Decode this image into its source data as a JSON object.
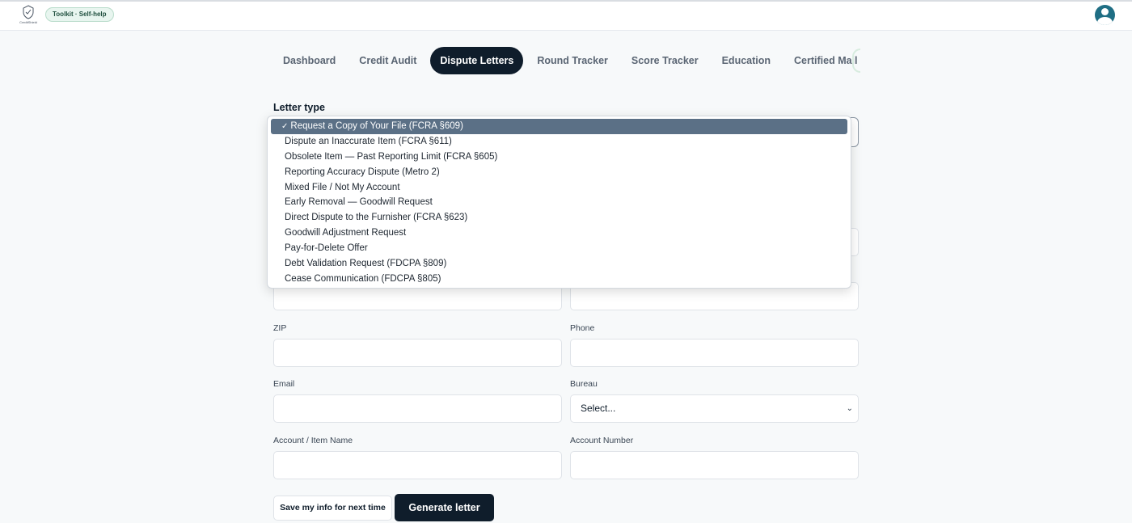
{
  "header": {
    "logo_text": "CreditShield",
    "badge": "Toolkit · Self-help"
  },
  "tabs": [
    {
      "label": "Dashboard",
      "active": false
    },
    {
      "label": "Credit Audit",
      "active": false
    },
    {
      "label": "Dispute Letters",
      "active": true
    },
    {
      "label": "Round Tracker",
      "active": false
    },
    {
      "label": "Score Tracker",
      "active": false
    },
    {
      "label": "Education",
      "active": false
    },
    {
      "label": "Certified Mail",
      "active": false
    }
  ],
  "form": {
    "letter_type_label": "Letter type",
    "letter_type_options": [
      "Request a Copy of Your File (FCRA §609)",
      "Dispute an Inaccurate Item (FCRA §611)",
      "Obsolete Item — Past Reporting Limit (FCRA §605)",
      "Reporting Accuracy Dispute (Metro 2)",
      "Mixed File / Not My Account",
      "Early Removal — Goodwill Request",
      "Direct Dispute to the Furnisher (FCRA §623)",
      "Goodwill Adjustment Request",
      "Pay-for-Delete Offer",
      "Debt Validation Request (FDCPA §809)",
      "Cease Communication (FDCPA §805)"
    ],
    "selected_check": "✓",
    "zip_label": "ZIP",
    "phone_label": "Phone",
    "email_label": "Email",
    "bureau_label": "Bureau",
    "bureau_value": "Select...",
    "account_label": "Account / Item Name",
    "account_number_label": "Account Number",
    "save_button": "Save my info for next time",
    "generate_button": "Generate letter"
  },
  "colors": {
    "primary": "#0f1d2b",
    "selected_option": "#5b7086",
    "badge_bg": "#e8f5ef",
    "avatar": "#1f6e84"
  }
}
